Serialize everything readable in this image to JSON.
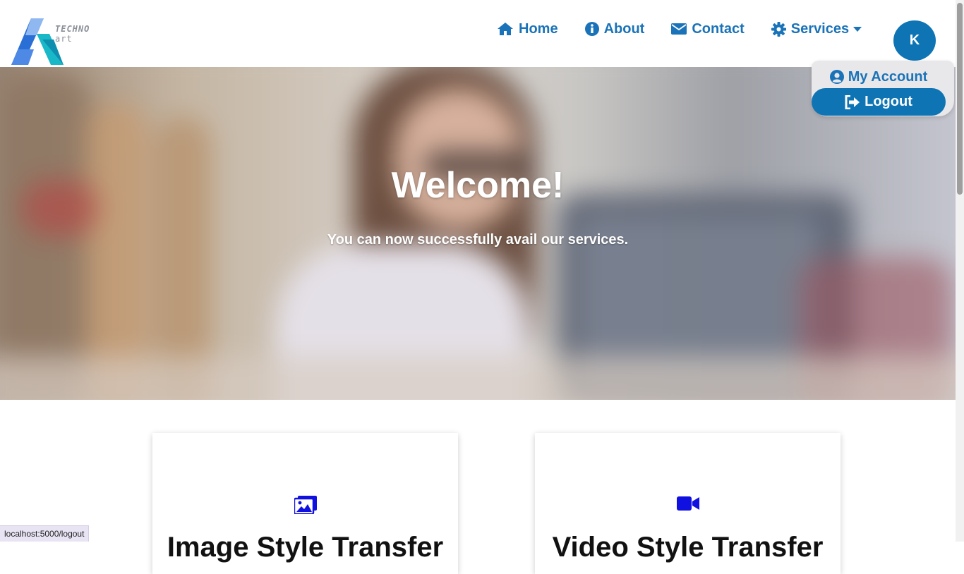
{
  "logo": {
    "brand": "TECHNO",
    "suffix": "art"
  },
  "nav": {
    "home": "Home",
    "about": "About",
    "contact": "Contact",
    "services": "Services"
  },
  "account": {
    "avatar_initial": "K",
    "my_account": "My Account",
    "logout": "Logout"
  },
  "hero": {
    "title": "Welcome!",
    "subtitle": "You can now successfully avail our services."
  },
  "cards": [
    {
      "icon": "images-icon",
      "title": "Image Style Transfer"
    },
    {
      "icon": "video-icon",
      "title": "Video Style Transfer"
    }
  ],
  "status": {
    "url": "localhost:5000/logout"
  },
  "colors": {
    "accent": "#1a73b8",
    "button": "#0e74b4",
    "card_icon": "#1010e0"
  }
}
